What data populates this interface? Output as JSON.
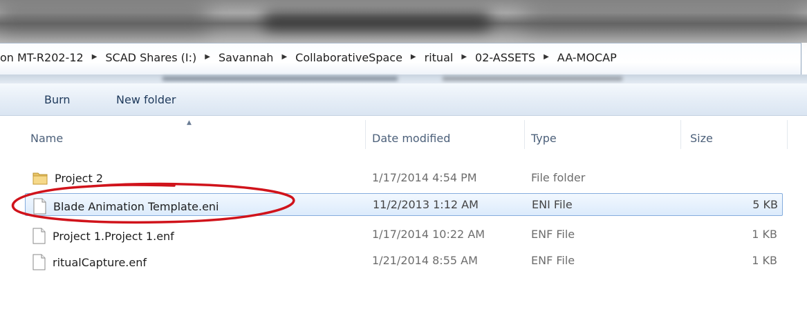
{
  "breadcrumb": {
    "items": [
      "on MT-R202-12",
      "SCAD Shares (I:)",
      "Savannah",
      "CollaborativeSpace",
      "ritual",
      "02-ASSETS",
      "AA-MOCAP"
    ]
  },
  "toolbar": {
    "burn_label": "Burn",
    "new_folder_label": "New folder"
  },
  "columns": {
    "name": "Name",
    "date": "Date modified",
    "type": "Type",
    "size": "Size"
  },
  "files": [
    {
      "name": "Project 2",
      "date": "1/17/2014 4:54 PM",
      "type": "File folder",
      "size": "",
      "icon": "folder-icon"
    },
    {
      "name": "Blade Animation Template.eni",
      "date": "11/2/2013 1:12 AM",
      "type": "ENI File",
      "size": "5 KB",
      "icon": "file-icon",
      "selected": true
    },
    {
      "name": "Project 1.Project 1.enf",
      "date": "1/17/2014 10:22 AM",
      "type": "ENF File",
      "size": "1 KB",
      "icon": "file-icon"
    },
    {
      "name": "ritualCapture.enf",
      "date": "1/21/2014 8:55 AM",
      "type": "ENF File",
      "size": "1 KB",
      "icon": "file-icon"
    }
  ],
  "colors": {
    "selection": "#dcebfc",
    "selection_border": "#84acdd",
    "annotation": "#d0131b"
  }
}
